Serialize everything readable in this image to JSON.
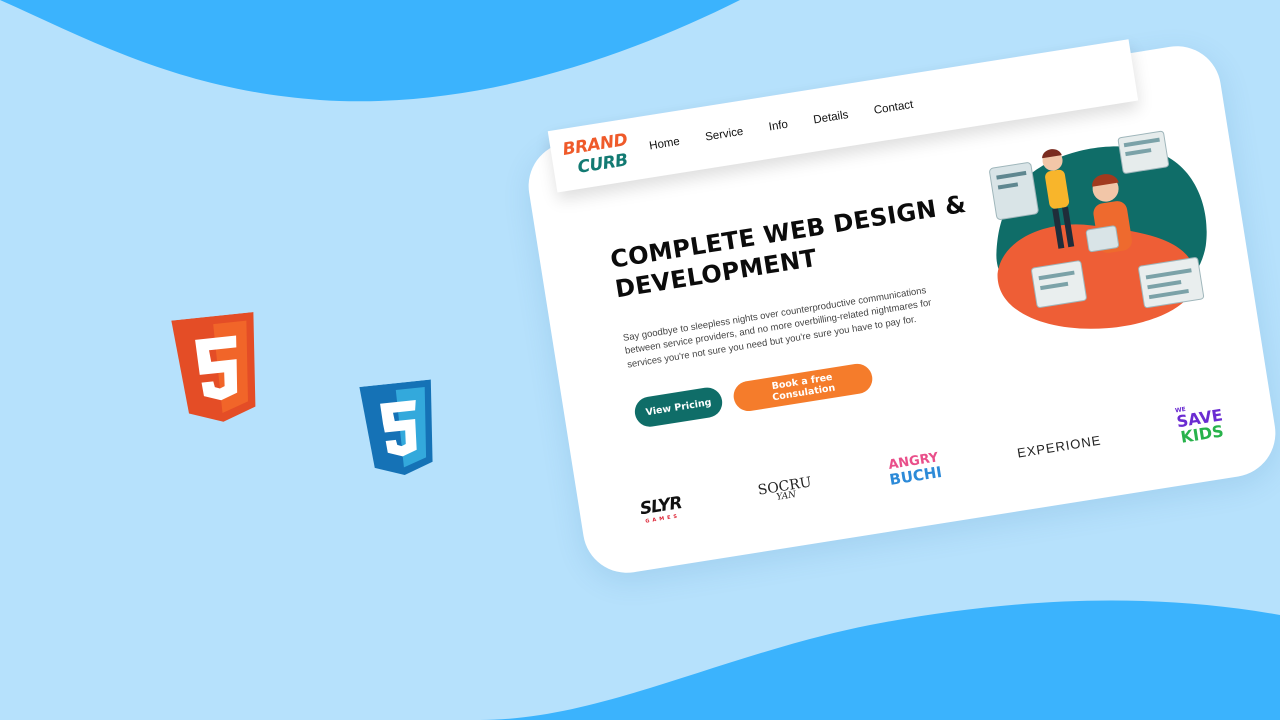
{
  "background": {
    "color": "#b6e1fc",
    "wave_color": "#3bb3fd"
  },
  "tech_icons": [
    {
      "name": "html5-icon",
      "color": "#f1652a"
    },
    {
      "name": "css3-icon",
      "color": "#2d8ef0"
    }
  ],
  "site": {
    "logo": {
      "line1": "BRAND",
      "line2": "CURB"
    },
    "nav": [
      "Home",
      "Service",
      "Info",
      "Details",
      "Contact"
    ],
    "hero": {
      "title": "COMPLETE WEB DESIGN & DEVELOPMENT",
      "description": "Say goodbye to sleepless nights over counterproductive communications between service providers, and no more overbilling-related nightmares for services you're not sure you need but you're sure you have to pay for.",
      "primary_button": "View Pricing",
      "secondary_button": "Book a free Consulation"
    },
    "brands": [
      {
        "main": "SLYR",
        "sub": "GAMES"
      },
      {
        "main": "SOCRU",
        "sub": "YAN"
      },
      {
        "main": "ANGRY",
        "sub": "BUCHI"
      },
      {
        "main": "EXPERIONE"
      },
      {
        "pre": "WE",
        "main": "SAVE",
        "sub": "KIDS"
      }
    ],
    "colors": {
      "accent_teal": "#0f6d68",
      "accent_orange": "#f57c2b"
    }
  }
}
